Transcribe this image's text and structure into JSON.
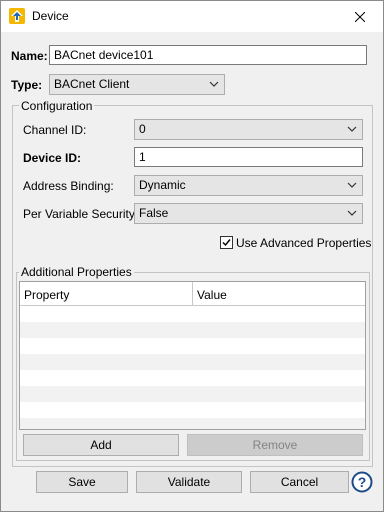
{
  "window": {
    "title": "Device"
  },
  "form": {
    "name_label": "Name:",
    "name_value": "BACnet device101",
    "type_label": "Type:",
    "type_value": "BACnet Client"
  },
  "configuration": {
    "title": "Configuration",
    "channel_label": "Channel ID:",
    "channel_value": "0",
    "device_id_label": "Device ID:",
    "device_id_value": "1",
    "address_binding_label": "Address Binding:",
    "address_binding_value": "Dynamic",
    "per_variable_security_label": "Per Variable Security:",
    "per_variable_security_value": "False",
    "advanced_label": "Use Advanced Properties",
    "advanced_checked": true
  },
  "additional_properties": {
    "title": "Additional Properties",
    "columns": [
      "Property",
      "Value"
    ],
    "rows": [],
    "add_label": "Add",
    "remove_label": "Remove"
  },
  "footer": {
    "save_label": "Save",
    "validate_label": "Validate",
    "cancel_label": "Cancel",
    "help_icon": "help-icon"
  },
  "colors": {
    "alt_row": "#f2f2f2",
    "icon_yellow": "#f5b800",
    "icon_blue": "#1f6bb5",
    "help_blue": "#1c4b8a"
  }
}
